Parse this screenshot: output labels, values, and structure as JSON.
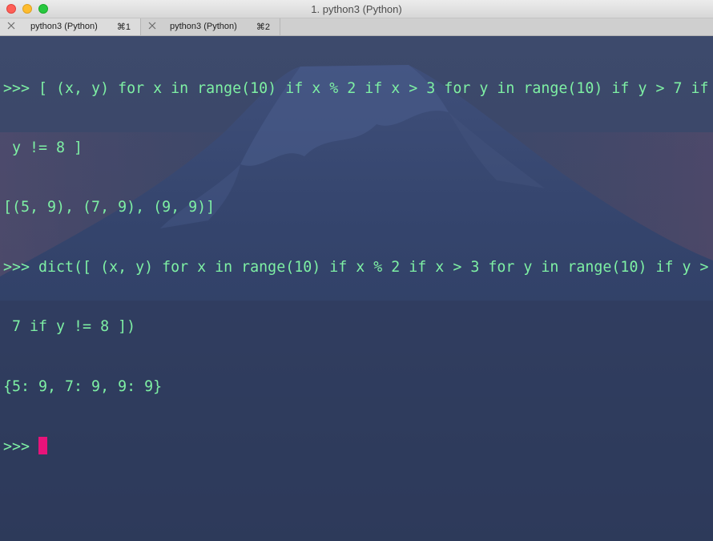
{
  "window": {
    "title": "1. python3 (Python)"
  },
  "tabs": [
    {
      "label": "python3 (Python)",
      "shortcut": "⌘1",
      "close_icon": "close-x-icon"
    },
    {
      "label": "python3 (Python)",
      "shortcut": "⌘2",
      "close_icon": "close-x-icon"
    }
  ],
  "terminal": {
    "lines": [
      ">>> [ (x, y) for x in range(10) if x % 2 if x > 3 for y in range(10) if y > 7 if",
      " y != 8 ]",
      "[(5, 9), (7, 9), (9, 9)]",
      ">>> dict([ (x, y) for x in range(10) if x % 2 if x > 3 for y in range(10) if y >",
      " 7 if y != 8 ])",
      "{5: 9, 7: 9, 9: 9}",
      ">>> "
    ],
    "text_color": "#7ef0a4",
    "cursor_color": "#e8137a"
  }
}
